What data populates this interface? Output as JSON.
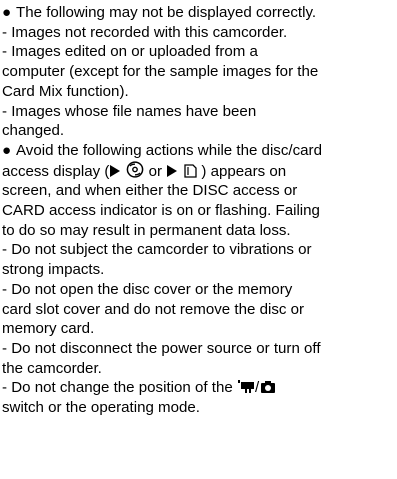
{
  "text": {
    "bullet": "●",
    "l1": "The following may not be displayed correctly.",
    "l2": "- Images not recorded with this camcorder.",
    "l3": "- Images edited on or uploaded from a",
    "l4": "computer (except for the sample images for the",
    "l5": "Card Mix function).",
    "l6": "- Images whose file names have been",
    "l7": "changed.",
    "l8": "Avoid the following actions while the disc/card",
    "l9a": "access display (",
    "l9b": " or ",
    "l9c": " ) appears on",
    "l10": "screen, and when either the DISC access or",
    "l11": "CARD access indicator is on or flashing. Failing",
    "l12": "to do so may result in permanent data loss.",
    "l13": "- Do not subject the camcorder to vibrations or",
    "l14": "strong impacts.",
    "l15": "- Do not open the disc cover or the memory",
    "l16": "card slot cover and do not remove the disc or",
    "l17": "memory card.",
    "l18": "- Do not disconnect the power source or turn off",
    "l19": "the camcorder.",
    "l20a": "- Do not change the position of the ",
    "l20b": "/",
    "l21": "switch or the operating mode."
  },
  "icons": {
    "play": "play-triangle-icon",
    "disc": "disc-icon",
    "card": "memory-card-icon",
    "movie": "movie-mode-icon",
    "camera": "camera-mode-icon"
  }
}
